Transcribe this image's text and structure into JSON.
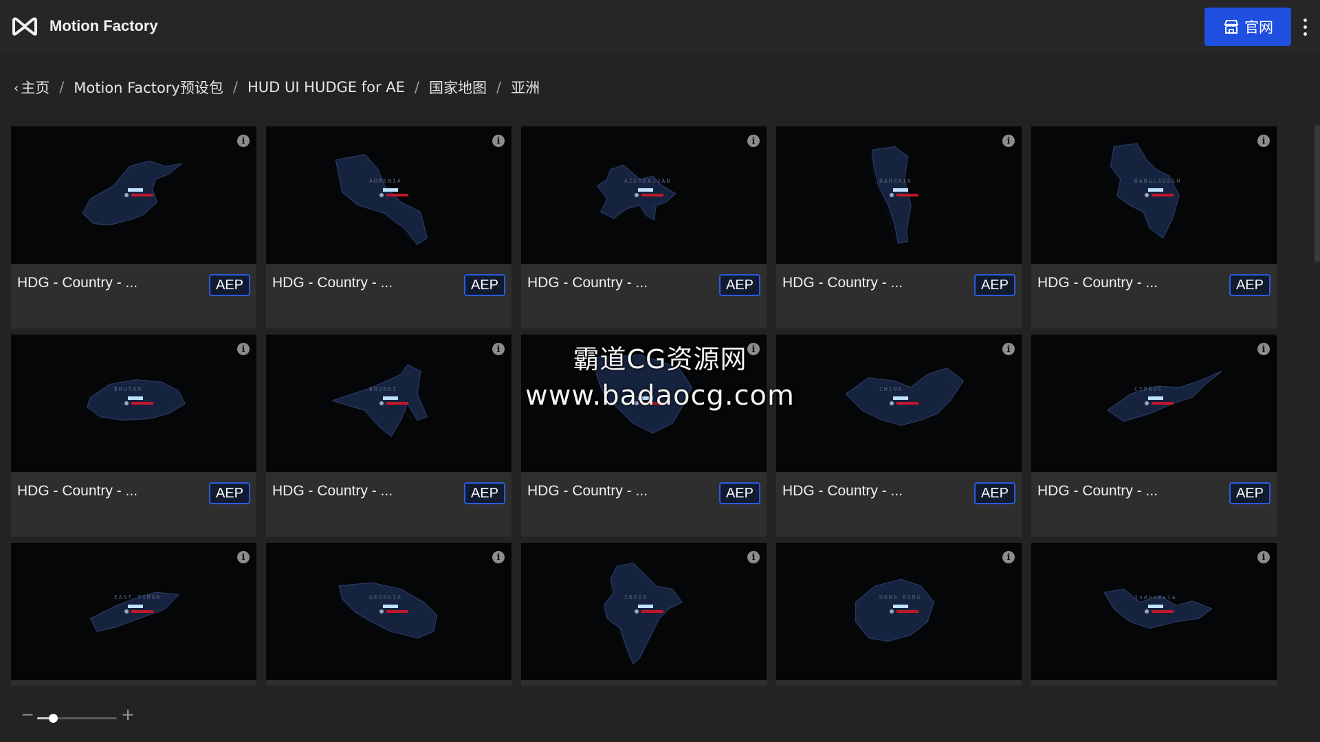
{
  "app": {
    "title": "Motion Factory"
  },
  "header": {
    "site_button_label": "官网",
    "site_button_icon": "store-icon",
    "more_icon": "more-vertical-icon"
  },
  "colors": {
    "accent": "#1f4fe0",
    "badge_border": "#2d5bdc",
    "map_fill": "#16233f",
    "label_red": "#c0182a",
    "label_blue": "#bfe3ff"
  },
  "breadcrumb": [
    {
      "label": "主页",
      "back": true
    },
    {
      "label": "Motion Factory预设包"
    },
    {
      "label": "HUD UI HUDGE for AE"
    },
    {
      "label": "国家地图"
    },
    {
      "label": "亚洲"
    }
  ],
  "cards": [
    {
      "title": "HDG - Country - ...",
      "badge": "AEP",
      "map": "afghanistan",
      "map_label": ""
    },
    {
      "title": "HDG - Country - ...",
      "badge": "AEP",
      "map": "armenia",
      "map_label": "ARMENIA"
    },
    {
      "title": "HDG - Country - ...",
      "badge": "AEP",
      "map": "azerbaijan",
      "map_label": "AZERBAIJAN"
    },
    {
      "title": "HDG - Country - ...",
      "badge": "AEP",
      "map": "bahrain",
      "map_label": "BAHRAIN"
    },
    {
      "title": "HDG - Country - ...",
      "badge": "AEP",
      "map": "bangladesh",
      "map_label": "BANGLADESH"
    },
    {
      "title": "HDG - Country - ...",
      "badge": "AEP",
      "map": "bhutan",
      "map_label": "BHUTAN"
    },
    {
      "title": "HDG - Country - ...",
      "badge": "AEP",
      "map": "brunei",
      "map_label": "BRUNEI"
    },
    {
      "title": "HDG - Country - ...",
      "badge": "AEP",
      "map": "cambodia",
      "map_label": ""
    },
    {
      "title": "HDG - Country - ...",
      "badge": "AEP",
      "map": "china",
      "map_label": "CHINA"
    },
    {
      "title": "HDG - Country - ...",
      "badge": "AEP",
      "map": "cyprus",
      "map_label": "CYPRUS"
    },
    {
      "title": "",
      "badge": "",
      "map": "east-timor",
      "map_label": "EAST TIMOR"
    },
    {
      "title": "",
      "badge": "",
      "map": "georgia",
      "map_label": "GEORGIA"
    },
    {
      "title": "",
      "badge": "",
      "map": "india",
      "map_label": "INDIA"
    },
    {
      "title": "",
      "badge": "",
      "map": "hong-kong",
      "map_label": "HONG KONG"
    },
    {
      "title": "",
      "badge": "",
      "map": "indonesia",
      "map_label": "Indonesia"
    }
  ],
  "watermark": {
    "line1": "霸道CG资源网",
    "line2": "www.badaocg.com"
  },
  "zoom": {
    "minus": "−",
    "plus": "+",
    "level": 0.2
  }
}
